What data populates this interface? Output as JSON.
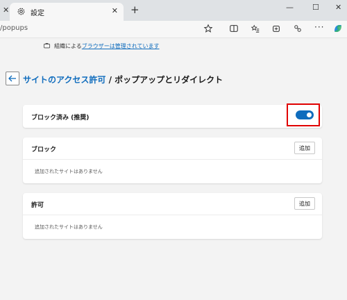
{
  "browser": {
    "tab_title": "設定",
    "tab_close": "✕",
    "new_tab": "+",
    "window_controls": {
      "minimize": "—",
      "maximize": "☐",
      "close": "✕"
    },
    "url": "/popups",
    "menu": "···"
  },
  "managed_notice": {
    "prefix": "組織による",
    "link": "ブラウザーは管理されています"
  },
  "breadcrumb": {
    "parent": "サイトのアクセス許可",
    "separator": " / ",
    "current": "ポップアップとリダイレクト"
  },
  "settings": {
    "blocked_recommended": {
      "label": "ブロック済み (推奨)",
      "toggle_on": true
    },
    "block": {
      "title": "ブロック",
      "add_label": "追加",
      "empty": "追加されたサイトはありません"
    },
    "allow": {
      "title": "許可",
      "add_label": "追加",
      "empty": "追加されたサイトはありません"
    }
  },
  "colors": {
    "accent": "#0f6cbd",
    "highlight": "#e00000"
  }
}
